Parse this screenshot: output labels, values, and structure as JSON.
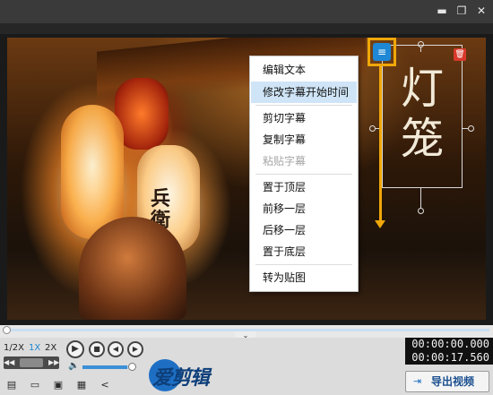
{
  "window": {
    "minimize_glyph": "▬",
    "maximize_glyph": "❐",
    "close_glyph": "✕"
  },
  "video": {
    "lantern_chars": "兵\n衛",
    "subtitle_text": "灯笼",
    "subtitle_menu_icon": "list-icon",
    "delete_icon": "trash-icon"
  },
  "context_menu": {
    "items": [
      {
        "label": "编辑文本",
        "state": "normal"
      },
      {
        "label": "修改字幕开始时间",
        "state": "active"
      },
      {
        "label": "剪切字幕",
        "state": "normal"
      },
      {
        "label": "复制字幕",
        "state": "normal"
      },
      {
        "label": "粘贴字幕",
        "state": "disabled"
      },
      {
        "label": "置于顶层",
        "state": "normal"
      },
      {
        "label": "前移一层",
        "state": "normal"
      },
      {
        "label": "后移一层",
        "state": "normal"
      },
      {
        "label": "置于底层",
        "state": "normal"
      },
      {
        "label": "转为贴图",
        "state": "normal"
      }
    ]
  },
  "timeline": {
    "toggle_glyph": "⌄",
    "position": 0.0
  },
  "playback": {
    "speeds": [
      "1/2X",
      "1X",
      "2X"
    ],
    "selected_speed": "1X",
    "play_glyph": "▶",
    "stop_glyph": "■",
    "prev_glyph": "◀",
    "next_glyph": "▶",
    "volume": 0.9,
    "current_time": "00:00:00.000",
    "total_time": "00:00:17.560"
  },
  "toolbar": {
    "icons": [
      "new-project-icon",
      "open-folder-icon",
      "save-icon",
      "save-as-icon",
      "share-icon"
    ],
    "glyphs": [
      "▤",
      "▭",
      "▣",
      "▦",
      "<"
    ]
  },
  "logo": {
    "text": "爱剪辑"
  },
  "export": {
    "label": "导出视频",
    "icon_glyph": "⇥"
  },
  "colors": {
    "accent": "#1e88d6",
    "highlight": "#f0a70a",
    "delete": "#d8392b",
    "menu_active": "#cfe5f7"
  }
}
